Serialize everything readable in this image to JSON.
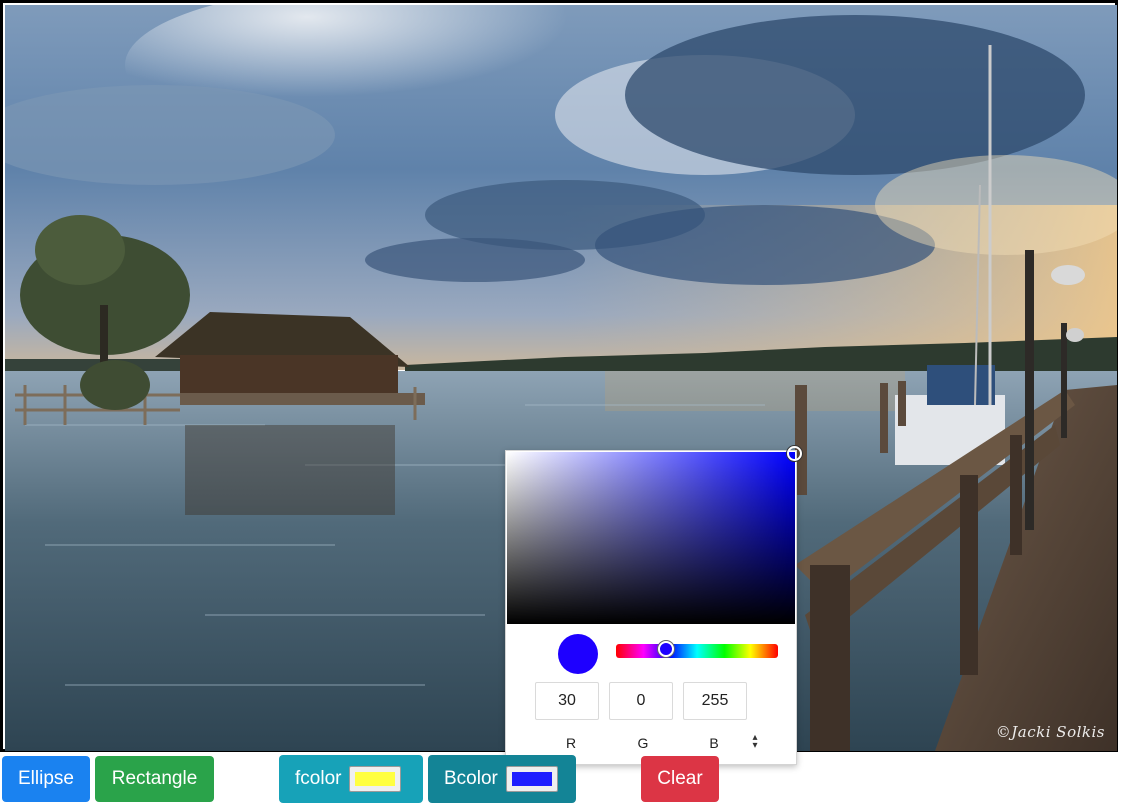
{
  "canvas": {
    "watermark": "©Jacki Solkis"
  },
  "picker": {
    "base_hue_color": "#0000ff",
    "selected_color": "#1e00ff",
    "hue_fraction": 0.31,
    "r": "30",
    "g": "0",
    "b": "255",
    "r_label": "R",
    "g_label": "G",
    "b_label": "B",
    "mode_toggle_icon": "up-down-arrows-icon"
  },
  "toolbar": {
    "ellipse_label": "Ellipse",
    "rectangle_label": "Rectangle",
    "fcolor_label": "fcolor",
    "fcolor_value": "#ffff40",
    "bcolor_label": "Bcolor",
    "bcolor_value": "#1e1eff",
    "clear_label": "Clear"
  },
  "colors": {
    "ellipse": "#1a82f0",
    "rectangle": "#2aa34a",
    "fcolor": "#17a2b8",
    "bcolor": "#138496",
    "clear": "#dc3545"
  }
}
